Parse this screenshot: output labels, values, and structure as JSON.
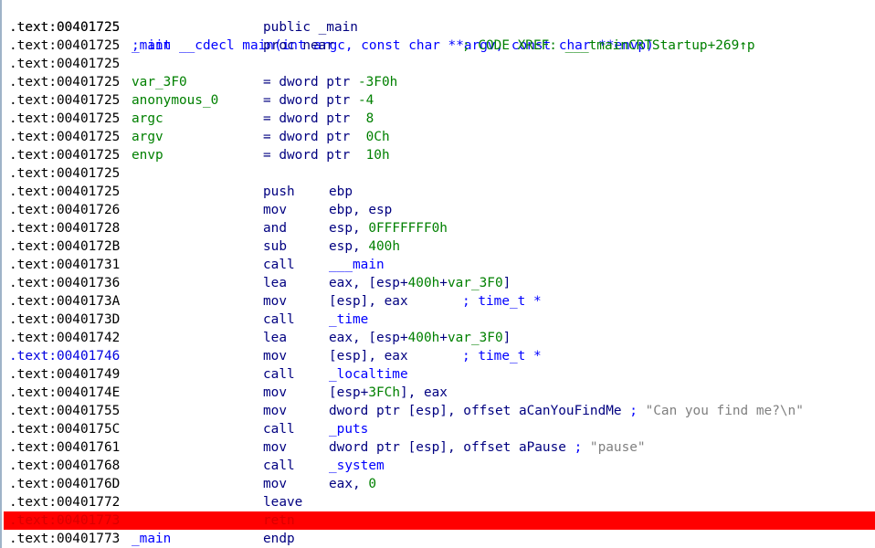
{
  "colors": {
    "highlight": "#ff0000",
    "mnemonic": "#000080",
    "name": "#0000ff",
    "number": "#008000",
    "string_comment": "#808080"
  },
  "listing": {
    "header": {
      "address": ".text:00401725",
      "text": "; int __cdecl main(int argc, const char **argv, const char **envp)"
    },
    "rows": [
      {
        "address": ".text:00401725",
        "directive": "public _main"
      },
      {
        "address": ".text:00401725",
        "label": "_main",
        "directive": "proc near",
        "xref": "; CODE XREF: ___tmainCRTStartup+269↑p"
      },
      {
        "address": ".text:00401725"
      },
      {
        "address": ".text:00401725",
        "var": "var_3F0",
        "def": "= dword ptr",
        "val": "-3F0h"
      },
      {
        "address": ".text:00401725",
        "var": "anonymous_0",
        "def": "= dword ptr",
        "val": "-4"
      },
      {
        "address": ".text:00401725",
        "var": "argc",
        "def": "= dword ptr",
        "val": " 8"
      },
      {
        "address": ".text:00401725",
        "var": "argv",
        "def": "= dword ptr",
        "val": " 0Ch"
      },
      {
        "address": ".text:00401725",
        "var": "envp",
        "def": "= dword ptr",
        "val": " 10h"
      },
      {
        "address": ".text:00401725"
      },
      {
        "address": ".text:00401725",
        "mnemonic": "push",
        "operands": "ebp"
      },
      {
        "address": ".text:00401726",
        "mnemonic": "mov",
        "operands": "ebp, esp"
      },
      {
        "address": ".text:00401728",
        "mnemonic": "and",
        "op_a": "esp, ",
        "op_num": "0FFFFFFF0h"
      },
      {
        "address": ".text:0040172B",
        "mnemonic": "sub",
        "op_a": "esp, ",
        "op_num": "400h"
      },
      {
        "address": ".text:00401731",
        "mnemonic": "call",
        "op_name": "___main"
      },
      {
        "address": ".text:00401736",
        "mnemonic": "lea",
        "op_a": "eax, [esp+",
        "op_num": "400h",
        "op_plus": "+",
        "op_var": "var_3F0",
        "op_end": "]"
      },
      {
        "address": ".text:0040173A",
        "mnemonic": "mov",
        "operands": "[esp], eax",
        "comment": "; time_t *"
      },
      {
        "address": ".text:0040173D",
        "mnemonic": "call",
        "op_name": "_time"
      },
      {
        "address": ".text:00401742",
        "mnemonic": "lea",
        "op_a": "eax, [esp+",
        "op_num": "400h",
        "op_plus": "+",
        "op_var": "var_3F0",
        "op_end": "]"
      },
      {
        "address": ".text:00401746",
        "mnemonic": "mov",
        "operands": "[esp], eax",
        "comment": "; time_t *",
        "current": true
      },
      {
        "address": ".text:00401749",
        "mnemonic": "call",
        "op_name": "_localtime"
      },
      {
        "address": ".text:0040174E",
        "mnemonic": "mov",
        "op_a": "[esp+",
        "op_num": "3FCh",
        "op_end": "], eax"
      },
      {
        "address": ".text:00401755",
        "mnemonic": "mov",
        "op_a": "dword ptr [esp], offset ",
        "op_off": "aCanYouFindMe",
        "op_semi": " ; ",
        "op_str": "\"Can you find me?\\n\""
      },
      {
        "address": ".text:0040175C",
        "mnemonic": "call",
        "op_name": "_puts"
      },
      {
        "address": ".text:00401761",
        "mnemonic": "mov",
        "op_a": "dword ptr [esp], offset ",
        "op_off": "aPause",
        "op_semi": " ; ",
        "op_str": "\"pause\""
      },
      {
        "address": ".text:00401768",
        "mnemonic": "call",
        "op_name": "_system"
      },
      {
        "address": ".text:0040176D",
        "mnemonic": "mov",
        "op_a": "eax, ",
        "op_num": "0"
      },
      {
        "address": ".text:00401772",
        "mnemonic": "leave"
      },
      {
        "address": ".text:00401773",
        "mnemonic": "retn",
        "highlighted": true
      },
      {
        "address": ".text:00401773",
        "label": "_main",
        "directive": "endp"
      }
    ]
  }
}
